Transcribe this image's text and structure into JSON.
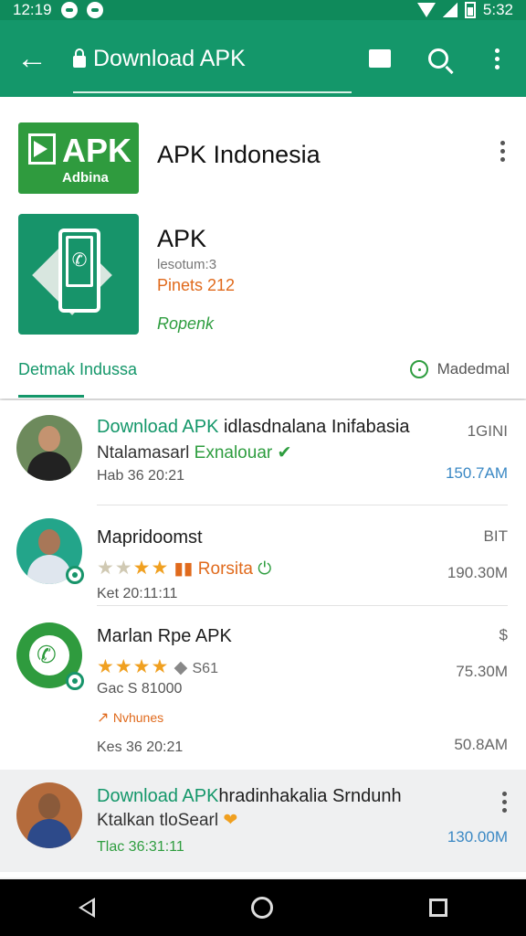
{
  "status_bar": {
    "time_left": "12:19",
    "time_right": "5:32"
  },
  "app_bar": {
    "title": "Download APK"
  },
  "card": {
    "logo_big": "APK",
    "logo_small": "Adbina",
    "title": "APK Indonesia",
    "app_name": "APK",
    "app_sub": "lesotum:3",
    "app_points": "Pinets 212",
    "app_open": "Ropenk",
    "tab_label": "Detmak Indussa",
    "right_label": "Madedmal"
  },
  "list": [
    {
      "title_hl": "Download APK",
      "title_rest": " idlasdnalana Inifabasia",
      "line2": "Ntalamasarl ",
      "line2_green": "Exnalouar",
      "meta": "Hab 36 20:21",
      "right_top": "1GINI",
      "right_bottom": "150.7AM"
    },
    {
      "title": "Mapridoomst",
      "rating": "Rorsita",
      "meta": "Ket 20:11:11",
      "right_top": "BIT",
      "right_bottom": "190.30M"
    },
    {
      "title": "Marlan Rpe APK",
      "rating_text": "S61",
      "meta": "Gac S 81000",
      "note": "Nvhunes",
      "meta2": "Kes 36 20:21",
      "right_top": "$",
      "right_mid": "75.30M",
      "right_bottom": "50.8AM"
    },
    {
      "title_hl": "Download APK",
      "title_rest": "hradinhakalia Srndunh",
      "line2": "Ktalkan tloSearl",
      "meta": "Tlac 36:31:11",
      "right_bottom": "130.00M"
    }
  ]
}
